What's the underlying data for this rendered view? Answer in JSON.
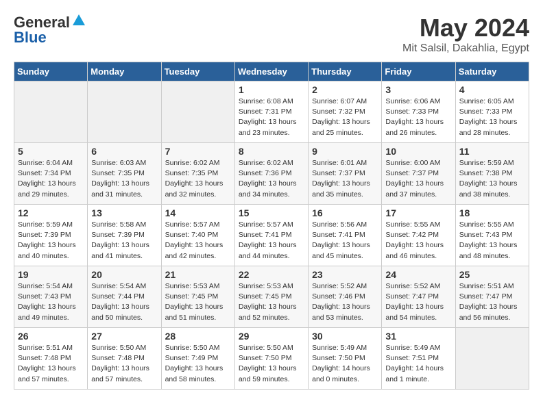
{
  "header": {
    "logo_line1": "General",
    "logo_line2": "Blue",
    "month_title": "May 2024",
    "location": "Mit Salsil, Dakahlia, Egypt"
  },
  "days_of_week": [
    "Sunday",
    "Monday",
    "Tuesday",
    "Wednesday",
    "Thursday",
    "Friday",
    "Saturday"
  ],
  "weeks": [
    [
      {
        "num": "",
        "info": ""
      },
      {
        "num": "",
        "info": ""
      },
      {
        "num": "",
        "info": ""
      },
      {
        "num": "1",
        "info": "Sunrise: 6:08 AM\nSunset: 7:31 PM\nDaylight: 13 hours\nand 23 minutes."
      },
      {
        "num": "2",
        "info": "Sunrise: 6:07 AM\nSunset: 7:32 PM\nDaylight: 13 hours\nand 25 minutes."
      },
      {
        "num": "3",
        "info": "Sunrise: 6:06 AM\nSunset: 7:33 PM\nDaylight: 13 hours\nand 26 minutes."
      },
      {
        "num": "4",
        "info": "Sunrise: 6:05 AM\nSunset: 7:33 PM\nDaylight: 13 hours\nand 28 minutes."
      }
    ],
    [
      {
        "num": "5",
        "info": "Sunrise: 6:04 AM\nSunset: 7:34 PM\nDaylight: 13 hours\nand 29 minutes."
      },
      {
        "num": "6",
        "info": "Sunrise: 6:03 AM\nSunset: 7:35 PM\nDaylight: 13 hours\nand 31 minutes."
      },
      {
        "num": "7",
        "info": "Sunrise: 6:02 AM\nSunset: 7:35 PM\nDaylight: 13 hours\nand 32 minutes."
      },
      {
        "num": "8",
        "info": "Sunrise: 6:02 AM\nSunset: 7:36 PM\nDaylight: 13 hours\nand 34 minutes."
      },
      {
        "num": "9",
        "info": "Sunrise: 6:01 AM\nSunset: 7:37 PM\nDaylight: 13 hours\nand 35 minutes."
      },
      {
        "num": "10",
        "info": "Sunrise: 6:00 AM\nSunset: 7:37 PM\nDaylight: 13 hours\nand 37 minutes."
      },
      {
        "num": "11",
        "info": "Sunrise: 5:59 AM\nSunset: 7:38 PM\nDaylight: 13 hours\nand 38 minutes."
      }
    ],
    [
      {
        "num": "12",
        "info": "Sunrise: 5:59 AM\nSunset: 7:39 PM\nDaylight: 13 hours\nand 40 minutes."
      },
      {
        "num": "13",
        "info": "Sunrise: 5:58 AM\nSunset: 7:39 PM\nDaylight: 13 hours\nand 41 minutes."
      },
      {
        "num": "14",
        "info": "Sunrise: 5:57 AM\nSunset: 7:40 PM\nDaylight: 13 hours\nand 42 minutes."
      },
      {
        "num": "15",
        "info": "Sunrise: 5:57 AM\nSunset: 7:41 PM\nDaylight: 13 hours\nand 44 minutes."
      },
      {
        "num": "16",
        "info": "Sunrise: 5:56 AM\nSunset: 7:41 PM\nDaylight: 13 hours\nand 45 minutes."
      },
      {
        "num": "17",
        "info": "Sunrise: 5:55 AM\nSunset: 7:42 PM\nDaylight: 13 hours\nand 46 minutes."
      },
      {
        "num": "18",
        "info": "Sunrise: 5:55 AM\nSunset: 7:43 PM\nDaylight: 13 hours\nand 48 minutes."
      }
    ],
    [
      {
        "num": "19",
        "info": "Sunrise: 5:54 AM\nSunset: 7:43 PM\nDaylight: 13 hours\nand 49 minutes."
      },
      {
        "num": "20",
        "info": "Sunrise: 5:54 AM\nSunset: 7:44 PM\nDaylight: 13 hours\nand 50 minutes."
      },
      {
        "num": "21",
        "info": "Sunrise: 5:53 AM\nSunset: 7:45 PM\nDaylight: 13 hours\nand 51 minutes."
      },
      {
        "num": "22",
        "info": "Sunrise: 5:53 AM\nSunset: 7:45 PM\nDaylight: 13 hours\nand 52 minutes."
      },
      {
        "num": "23",
        "info": "Sunrise: 5:52 AM\nSunset: 7:46 PM\nDaylight: 13 hours\nand 53 minutes."
      },
      {
        "num": "24",
        "info": "Sunrise: 5:52 AM\nSunset: 7:47 PM\nDaylight: 13 hours\nand 54 minutes."
      },
      {
        "num": "25",
        "info": "Sunrise: 5:51 AM\nSunset: 7:47 PM\nDaylight: 13 hours\nand 56 minutes."
      }
    ],
    [
      {
        "num": "26",
        "info": "Sunrise: 5:51 AM\nSunset: 7:48 PM\nDaylight: 13 hours\nand 57 minutes."
      },
      {
        "num": "27",
        "info": "Sunrise: 5:50 AM\nSunset: 7:48 PM\nDaylight: 13 hours\nand 57 minutes."
      },
      {
        "num": "28",
        "info": "Sunrise: 5:50 AM\nSunset: 7:49 PM\nDaylight: 13 hours\nand 58 minutes."
      },
      {
        "num": "29",
        "info": "Sunrise: 5:50 AM\nSunset: 7:50 PM\nDaylight: 13 hours\nand 59 minutes."
      },
      {
        "num": "30",
        "info": "Sunrise: 5:49 AM\nSunset: 7:50 PM\nDaylight: 14 hours\nand 0 minutes."
      },
      {
        "num": "31",
        "info": "Sunrise: 5:49 AM\nSunset: 7:51 PM\nDaylight: 14 hours\nand 1 minute."
      },
      {
        "num": "",
        "info": ""
      }
    ]
  ]
}
